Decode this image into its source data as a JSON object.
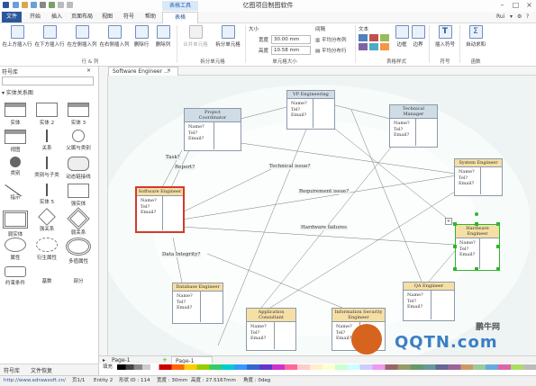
{
  "window": {
    "title": "亿图项目制图软件",
    "context_tab": "表格工具",
    "user": "Rui"
  },
  "menu": {
    "tabs": [
      "文件",
      "开始",
      "插入",
      "页面布局",
      "视图",
      "符号",
      "帮助",
      "表格"
    ]
  },
  "ribbon": {
    "rowcol_buttons": [
      "在上方插入行",
      "在下方插入行",
      "在左侧插入列",
      "在右侧插入列",
      "删除行",
      "删除列"
    ],
    "rowcol_group": "行 & 列",
    "merge_buttons": [
      "合并单元格",
      "拆分单元格"
    ],
    "merge_group": "拆分单元格",
    "size": {
      "label": "大小",
      "width_label": "宽度",
      "width_value": "30.00 mm",
      "height_label": "高度",
      "height_value": "10.58 mm",
      "group": "单元格大小"
    },
    "spacing": {
      "label": "间隔",
      "avg_row": "平均分布列",
      "avg_col": "平均分布行"
    },
    "style": {
      "label": "文本",
      "group": "表格样式",
      "border": "边框",
      "edge": "边界"
    },
    "symbol": {
      "label": "插入符号",
      "group": "符号"
    },
    "func": {
      "label": "自动求和",
      "group": "函数"
    }
  },
  "left_panel": {
    "title": "符号库",
    "section": "实体关系图",
    "symbols": [
      "实体",
      "实体 2",
      "实体 3",
      "视图",
      "关系",
      "父属与类别",
      "类别",
      "类别与子类",
      "动态链接线",
      "指示",
      "实体 5",
      "强实体",
      "弱实体",
      "强关系",
      "弱关系",
      "属性",
      "衍生属性",
      "多值属性",
      "约束条件",
      "基数",
      "部分"
    ],
    "tabs": [
      "符号库",
      "文件恢复"
    ]
  },
  "document": {
    "tab": "Software Engineer ..."
  },
  "diagram": {
    "entities": [
      {
        "title": "Project\nCoordinator",
        "attrs": [
          "Name?",
          "Tel?",
          "Email?"
        ],
        "color": "blue"
      },
      {
        "title": "VP Engineering",
        "attrs": [
          "Name?",
          "Tel?",
          "Email?"
        ],
        "color": "blue"
      },
      {
        "title": "Technical\nManager",
        "attrs": [
          "Name?",
          "Tel?",
          "Email?"
        ],
        "color": "blue"
      },
      {
        "title": "System Engineer",
        "attrs": [
          "Name?",
          "Tel?",
          "Email?"
        ],
        "color": "yellow"
      },
      {
        "title": "Software Engineer",
        "attrs": [
          "Name?",
          "Tel?",
          "Email?"
        ],
        "color": "yellow"
      },
      {
        "title": "Hardware\nEngineer",
        "attrs": [
          "Name?",
          "Tel?",
          "Email?"
        ],
        "color": "yellow"
      },
      {
        "title": "Database Engineer",
        "attrs": [
          "Name?",
          "Tel?",
          "Email?"
        ],
        "color": "yellow"
      },
      {
        "title": "Application\nConsultant",
        "attrs": [
          "Name?",
          "Tel?",
          "Email?"
        ],
        "color": "yellow"
      },
      {
        "title": "Information Security\nEngineer",
        "attrs": [
          "Name?",
          "Tel?",
          "Email?"
        ],
        "color": "yellow"
      },
      {
        "title": "QA Engineer",
        "attrs": [
          "Name?",
          "Tel?",
          "Email?"
        ],
        "color": "yellow"
      }
    ],
    "relations": [
      "Task?",
      "Report?",
      "Technical issue?",
      "Requirement issue?",
      "Hardware failures",
      "Data Integrity?"
    ]
  },
  "pagebar": {
    "page_tab": "Page-1",
    "page_label": "Page-1"
  },
  "palette_label": "填充",
  "status": {
    "url": "http://www.edrawsoft.cn/",
    "page": "页1/1",
    "entity": "Entity 2",
    "shape_id": "形状 ID : 114",
    "width": "宽度 : 30mm",
    "height": "高度 : 27.5167mm",
    "angle": "角度 : 0deg"
  },
  "watermark": {
    "cn": "鹏牛网",
    "en": "QQTN.com"
  },
  "colors": {
    "accent": "#2b579a",
    "selected": "#d23a2a",
    "handles": "#2fb52f"
  }
}
